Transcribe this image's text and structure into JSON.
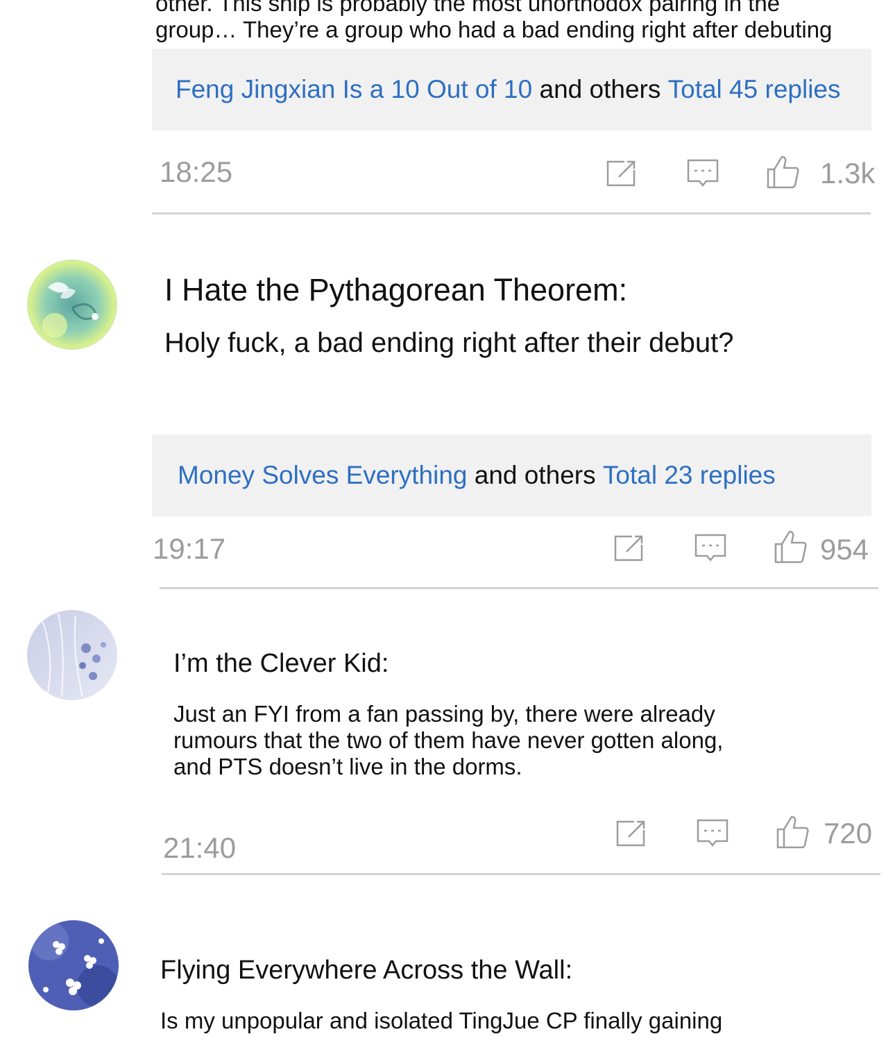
{
  "comments": [
    {
      "text": "other. This ship is probably the most unorthodox pairing in the\ngroup… They’re a group who had a bad ending right after debuting",
      "replies": {
        "first_replier": "Feng Jingxian Is a 10 Out of 10",
        "and_others": " and others ",
        "total": "Total 45 replies"
      },
      "time": "18:25",
      "likes": "1.3k"
    },
    {
      "username": "I Hate the Pythagorean Theorem:",
      "text": "Holy fuck, a bad ending right after their debut?",
      "replies": {
        "first_replier": "Money Solves Everything",
        "and_others": " and others ",
        "total": "Total 23 replies"
      },
      "time": "19:17",
      "likes": "954"
    },
    {
      "username": "I’m the Clever Kid:",
      "text": "Just an FYI from a fan passing by, there were already\nrumours that the two of them have never gotten along,\nand PTS doesn’t live in the dorms.",
      "time": "21:40",
      "likes": "720"
    },
    {
      "username": "Flying Everywhere Across the Wall:",
      "text": "Is my unpopular and isolated TingJue CP finally gaining"
    }
  ],
  "icons": {
    "share": "share-icon",
    "comment": "comment-icon",
    "like": "thumbs-up-icon"
  },
  "colors": {
    "link": "#2d6fc2",
    "muted": "#9c9c9c",
    "reply_bg": "#f1f1f1"
  }
}
